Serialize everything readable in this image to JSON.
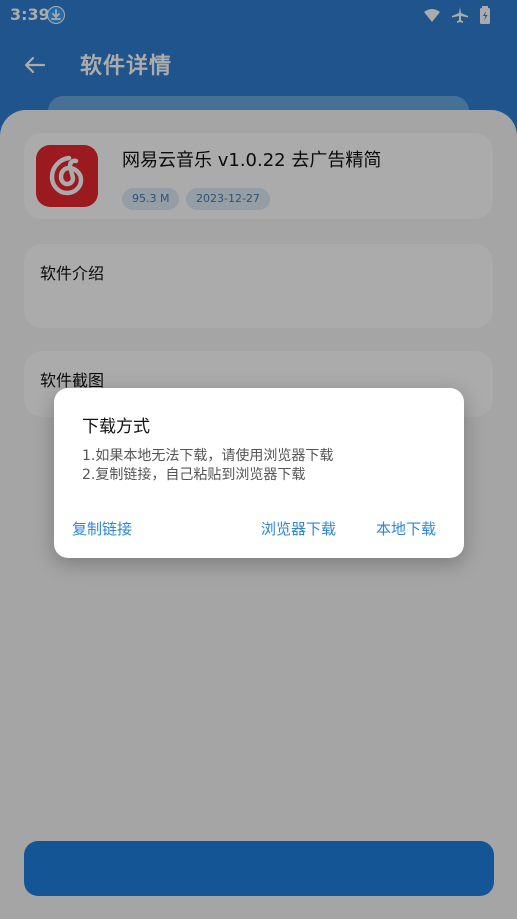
{
  "status_bar": {
    "time": "3:39",
    "icons": [
      "download-badge-icon",
      "wifi-icon",
      "airplane-icon",
      "battery-icon"
    ]
  },
  "app_bar": {
    "title": "软件详情",
    "back_icon": "arrow-left-icon"
  },
  "app": {
    "name": "网易云音乐 v1.0.22 去广告精简",
    "size": "95.3 M",
    "date": "2023-12-27",
    "icon": "netease-music-icon"
  },
  "sections": {
    "intro_title": "软件介绍",
    "screenshots_title": "软件截图"
  },
  "dialog": {
    "title": "下载方式",
    "lines": [
      "1.如果本地无法下载，请使用浏览器下载",
      "2.复制链接，自己粘贴到浏览器下载"
    ],
    "actions": {
      "copy": "复制链接",
      "browser": "浏览器下载",
      "local": "本地下载"
    }
  },
  "colors": {
    "header_blue": "#2f7fd1",
    "accent": "#2d86da",
    "icon_red": "#e8272f",
    "button_blue": "#1f7fe0"
  }
}
